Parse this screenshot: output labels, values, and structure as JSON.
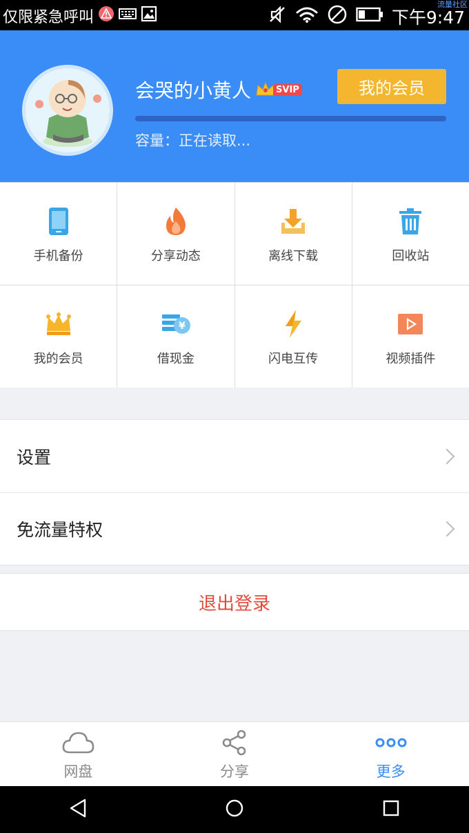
{
  "status_bar": {
    "left_text": "仅限紧急呼叫",
    "time": "下午9:47",
    "watermark": "流量社区"
  },
  "header": {
    "username": "会哭的小黄人",
    "badge": "SVIP",
    "member_button": "我的会员",
    "capacity": "容量：正在读取...",
    "progress": 0,
    "colors": {
      "bg": "#3a8cf6",
      "button": "#f4b62f"
    }
  },
  "grid": [
    {
      "label": "手机备份",
      "icon": "phone-icon"
    },
    {
      "label": "分享动态",
      "icon": "flame-icon"
    },
    {
      "label": "离线下载",
      "icon": "download-icon"
    },
    {
      "label": "回收站",
      "icon": "trash-icon"
    },
    {
      "label": "我的会员",
      "icon": "crown-icon"
    },
    {
      "label": "借现金",
      "icon": "cash-icon"
    },
    {
      "label": "闪电互传",
      "icon": "lightning-icon"
    },
    {
      "label": "视频插件",
      "icon": "video-play-icon"
    }
  ],
  "list": [
    {
      "label": "设置"
    },
    {
      "label": "免流量特权"
    }
  ],
  "logout": "退出登录",
  "tabs": [
    {
      "label": "网盘",
      "icon": "cloud-icon",
      "active": false
    },
    {
      "label": "分享",
      "icon": "share-icon",
      "active": false
    },
    {
      "label": "更多",
      "icon": "more-dots-icon",
      "active": true
    }
  ]
}
